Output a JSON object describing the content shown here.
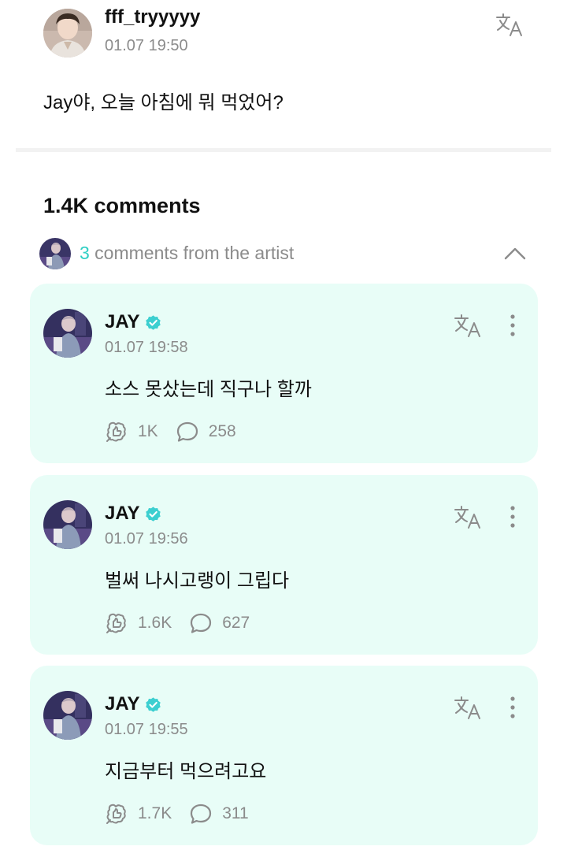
{
  "post": {
    "username": "fff_tryyyyy",
    "time": "01.07 19:50",
    "text": "Jay야, 오늘 아침에 뭐 먹었어?"
  },
  "comments_count": "1.4K comments",
  "artist_section": {
    "count": "3",
    "label": " comments from the artist"
  },
  "artist_comments": [
    {
      "name": "JAY",
      "time": "01.07 19:58",
      "text": "소스 못샀는데 직구나 할까",
      "likes": "1K",
      "replies": "258"
    },
    {
      "name": "JAY",
      "time": "01.07 19:56",
      "text": "벌써 나시고랭이 그립다",
      "likes": "1.6K",
      "replies": "627"
    },
    {
      "name": "JAY",
      "time": "01.07 19:55",
      "text": "지금부터 먹으려고요",
      "likes": "1.7K",
      "replies": "311"
    }
  ],
  "colors": {
    "accent": "#2fcfc4",
    "card_bg": "#e8fdf7",
    "muted_text": "#8b8b8b",
    "verified_badge": "#3ccfd0"
  },
  "icons": {
    "translate": "translate-icon",
    "verified": "verified-badge-icon",
    "more": "more-vertical-icon",
    "like": "like-icon",
    "reply": "comment-bubble-icon",
    "collapse": "chevron-up-icon"
  }
}
